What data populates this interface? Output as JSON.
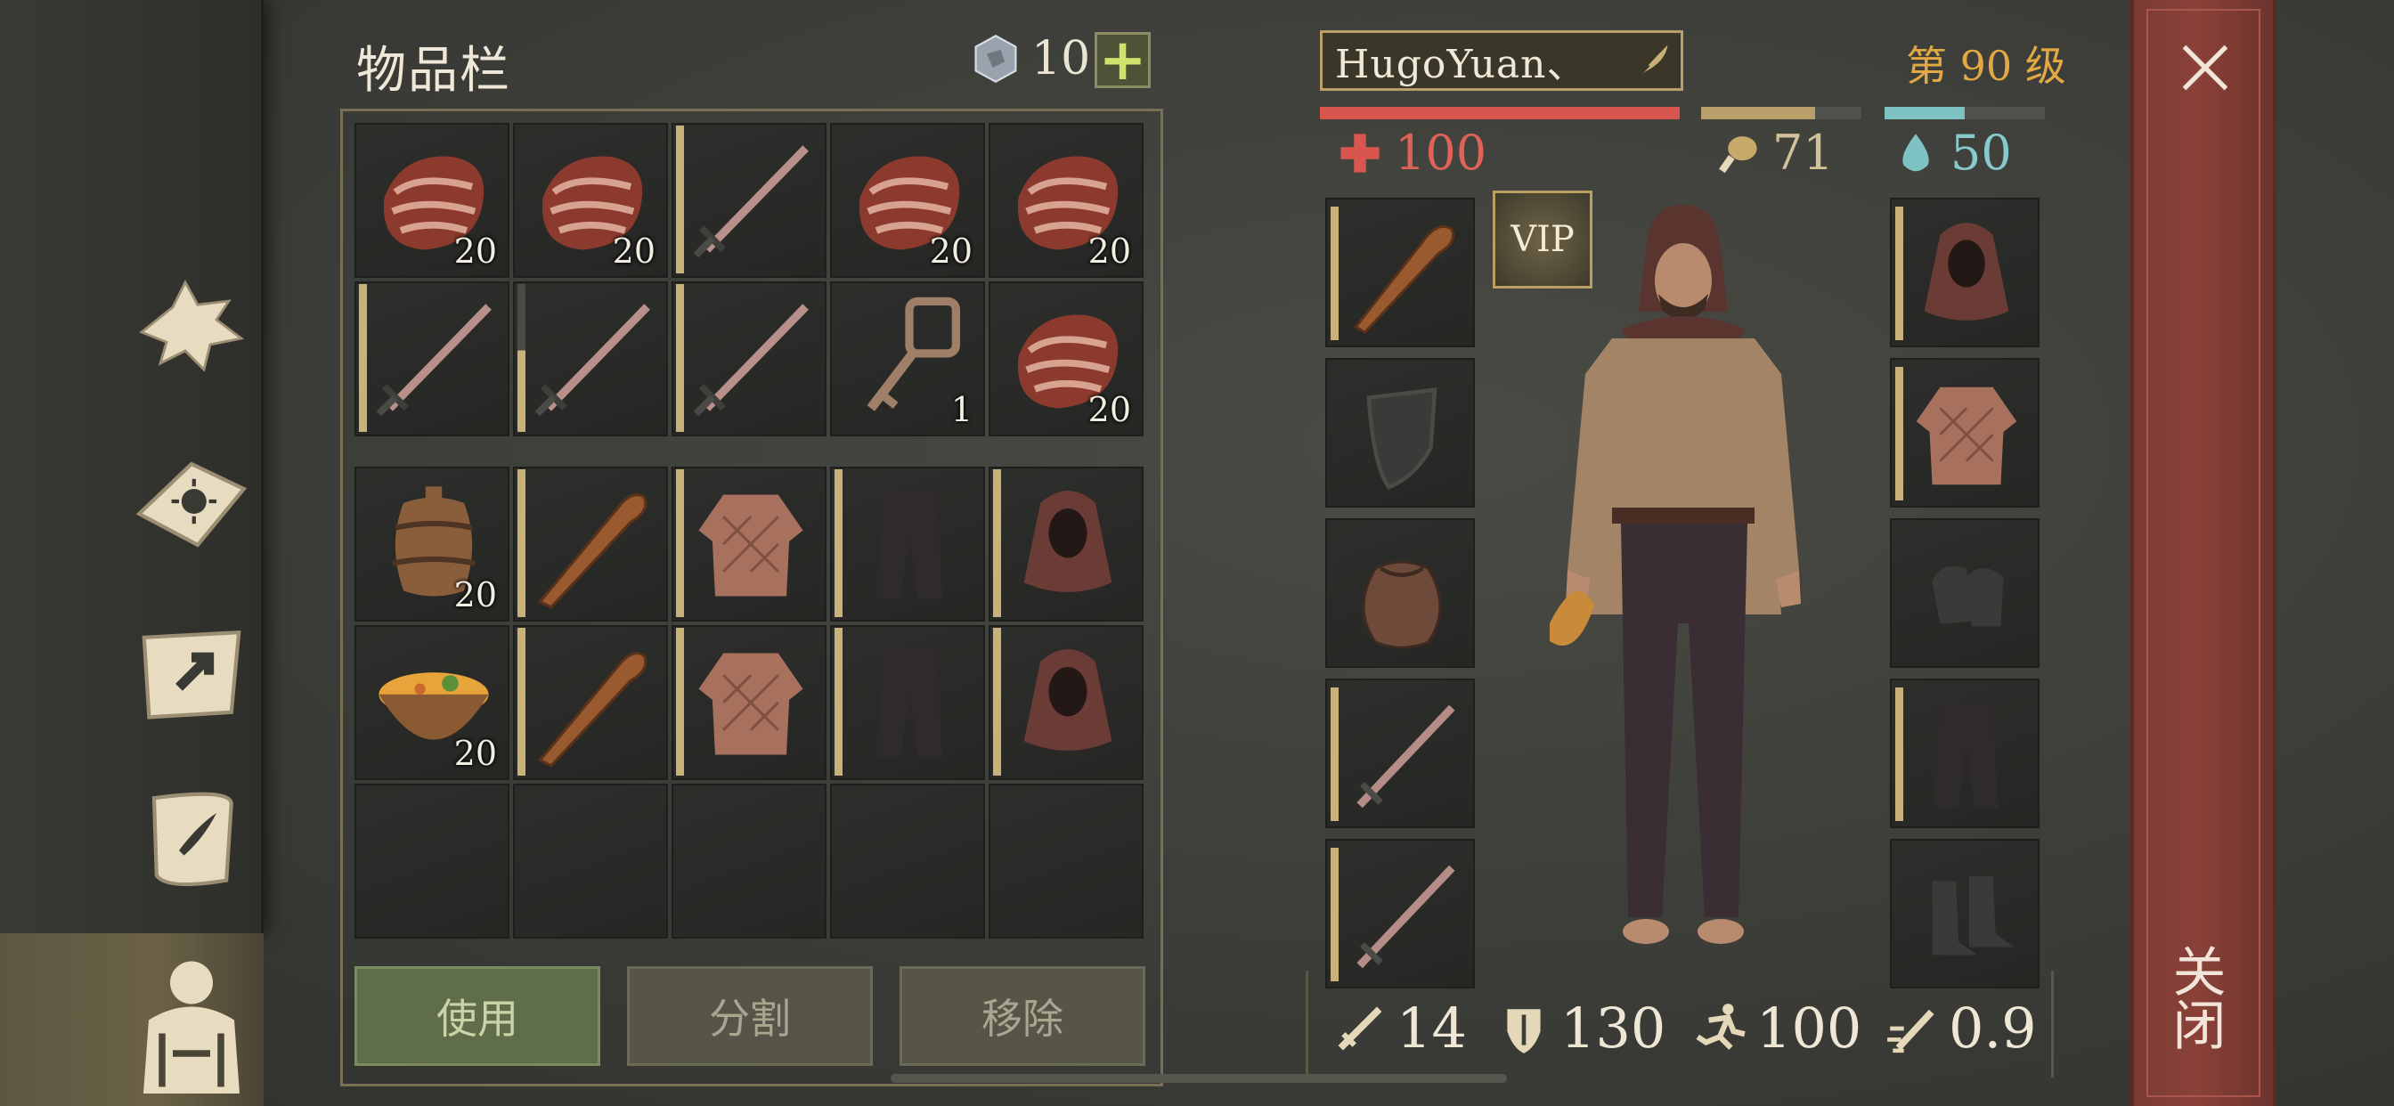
{
  "inventory": {
    "title": "物品栏",
    "currency_count": "10",
    "plus_label": "+",
    "slots": [
      {
        "item": "raw-meat",
        "qty": "20"
      },
      {
        "item": "raw-meat",
        "qty": "20"
      },
      {
        "item": "sword",
        "qty": ""
      },
      {
        "item": "raw-meat",
        "qty": "20"
      },
      {
        "item": "raw-meat",
        "qty": "20"
      },
      {
        "item": "sword",
        "qty": ""
      },
      {
        "item": "sword",
        "qty": ""
      },
      {
        "item": "sword",
        "qty": ""
      },
      {
        "item": "key",
        "qty": "1"
      },
      {
        "item": "raw-meat",
        "qty": "20"
      },
      {
        "item": "barrel",
        "qty": "20"
      },
      {
        "item": "club",
        "qty": ""
      },
      {
        "item": "gambeson",
        "qty": ""
      },
      {
        "item": "trousers",
        "qty": ""
      },
      {
        "item": "hood",
        "qty": ""
      },
      {
        "item": "stew-bowl",
        "qty": "20"
      },
      {
        "item": "club",
        "qty": ""
      },
      {
        "item": "gambeson",
        "qty": ""
      },
      {
        "item": "trousers",
        "qty": ""
      },
      {
        "item": "hood",
        "qty": ""
      },
      {
        "item": "empty",
        "qty": ""
      },
      {
        "item": "empty",
        "qty": ""
      },
      {
        "item": "empty",
        "qty": ""
      },
      {
        "item": "empty",
        "qty": ""
      },
      {
        "item": "empty",
        "qty": ""
      }
    ],
    "buttons": {
      "use": "使用",
      "split": "分割",
      "remove": "移除"
    }
  },
  "character": {
    "name": "HugoYuan、",
    "level": "第 90 级",
    "health": "100",
    "food": "71",
    "water": "50",
    "health_fill": 1.0,
    "food_fill": 0.71,
    "water_fill": 0.5,
    "vip_label": "VIP",
    "left_equipment": [
      "club",
      "shield-empty",
      "pouch",
      "sword",
      "sword"
    ],
    "right_equipment": [
      "hood",
      "gambeson",
      "gloves-empty",
      "trousers",
      "boots-empty"
    ],
    "stats": {
      "attack": "14",
      "armor": "130",
      "speed": "100",
      "attack_speed": "0.9"
    }
  },
  "close_label": "关闭",
  "colors": {
    "health": "#d9564f",
    "food": "#b9a06a",
    "water": "#7fc2c4",
    "level": "#e2a843",
    "accent_gold": "#c8b27a"
  },
  "sidebar_icons": [
    "wolf-icon",
    "sun-book-icon",
    "map-icon",
    "scroll-icon",
    "character-icon"
  ]
}
